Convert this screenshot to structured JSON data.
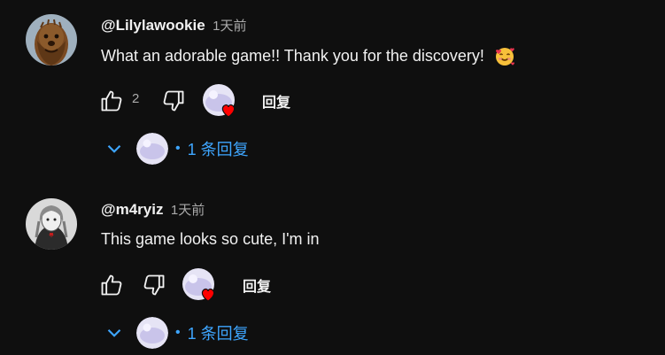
{
  "comments": [
    {
      "username": "@Lilylawookie",
      "timestamp": "1天前",
      "text": "What an adorable game!! Thank you for the discovery!",
      "emoji": "smiling-face-with-hearts",
      "likes": "2",
      "reply_label": "回复",
      "replies_count": "1 条回复"
    },
    {
      "username": "@m4ryiz",
      "timestamp": "1天前",
      "text": "This game looks so cute, I'm in",
      "likes": "",
      "reply_label": "回复",
      "replies_count": "1 条回复"
    }
  ],
  "colors": {
    "background": "#0f0f0f",
    "text": "#f1f1f1",
    "muted": "#aaaaaa",
    "link_blue": "#3ea6ff",
    "heart_red": "#ff0000"
  }
}
